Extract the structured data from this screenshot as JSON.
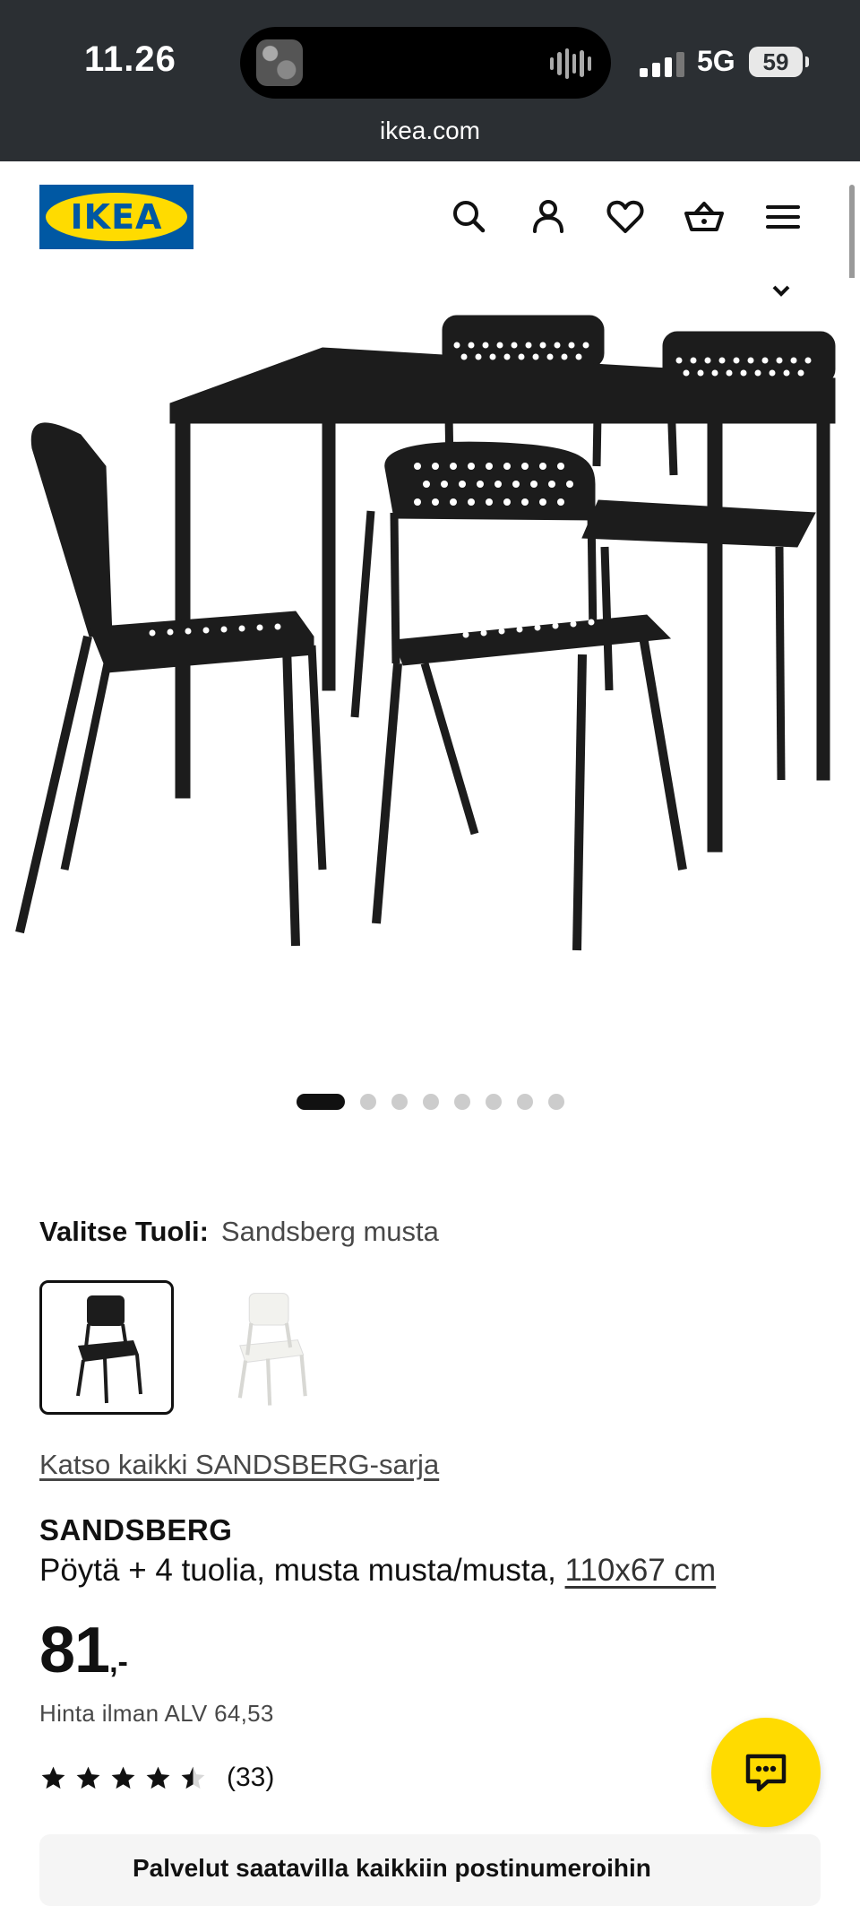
{
  "status_bar": {
    "time": "11.26",
    "network": "5G",
    "battery": "59",
    "url": "ikea.com"
  },
  "header": {
    "logo_text": "IKEA",
    "brand_colors": {
      "blue": "#0058a3",
      "yellow": "#ffdb00"
    },
    "icons": [
      "search-icon",
      "account-icon",
      "heart-icon",
      "basket-icon",
      "menu-icon"
    ]
  },
  "gallery": {
    "image_alt": "SANDSBERG table with 4 black chairs",
    "total_images": 8,
    "active_index": 0
  },
  "variant": {
    "label": "Valitse Tuoli:",
    "selected_value": "Sandsberg musta",
    "options": [
      "black-chair",
      "white-chair"
    ]
  },
  "product": {
    "series_link": "Katso kaikki SANDSBERG-sarja",
    "name": "SANDSBERG",
    "description": "Pöytä + 4 tuolia, musta musta/musta,",
    "size_link": "110x67 cm",
    "price_main": "81",
    "price_suffix": ",-",
    "vat_text": "Hinta ilman ALV 64,53",
    "rating": 4.5,
    "rating_max": 5,
    "review_count": "(33)"
  },
  "info_box": {
    "text": "Palvelut saatavilla kaikkiin postinumeroihin"
  },
  "chat_button": {
    "icon": "chat-icon"
  }
}
